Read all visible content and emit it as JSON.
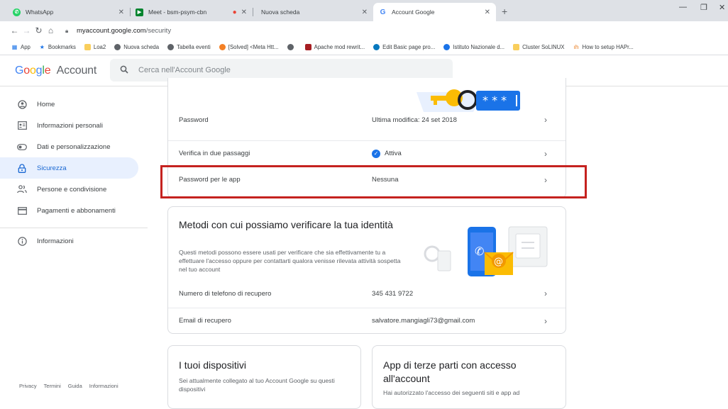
{
  "tabs": [
    {
      "title": "WhatsApp",
      "color": "#25d366"
    },
    {
      "title": "Meet - bsm-psym-cbn",
      "color": "#00832d"
    },
    {
      "title": "Nuova scheda",
      "color": "#ea4335"
    },
    {
      "title": "Account Google",
      "color": "#4285f4"
    }
  ],
  "address": {
    "host": "myaccount.google.com",
    "path": "/security"
  },
  "bookmarks": [
    "App",
    "Bookmarks",
    "Loa2",
    "Nuova scheda",
    "Tabella eventi",
    "[Solved] <Meta Htt...",
    "",
    "Apache mod rewrit...",
    "Edit Basic page pro...",
    "Istituto Nazionale d...",
    "Cluster SoLINUX",
    "How to setup HAPr..."
  ],
  "header": {
    "logo_google": "Google",
    "logo_account": "Account",
    "search_placeholder": "Cerca nell'Account Google"
  },
  "sidebar": {
    "items": [
      {
        "label": "Home",
        "icon": "home-icon"
      },
      {
        "label": "Informazioni personali",
        "icon": "id-card-icon"
      },
      {
        "label": "Dati e personalizzazione",
        "icon": "toggle-icon"
      },
      {
        "label": "Sicurezza",
        "icon": "lock-icon"
      },
      {
        "label": "Persone e condivisione",
        "icon": "people-icon"
      },
      {
        "label": "Pagamenti e abbonamenti",
        "icon": "card-icon"
      },
      {
        "label": "Informazioni",
        "icon": "info-icon"
      }
    ],
    "footer": [
      "Privacy",
      "Termini",
      "Guida",
      "Informazioni"
    ]
  },
  "signin": {
    "rows": [
      {
        "label": "Password",
        "value": "Ultima modifica: 24 set 2018"
      },
      {
        "label": "Verifica in due passaggi",
        "value": "Attiva"
      },
      {
        "label": "Password per le app",
        "value": "Nessuna"
      }
    ]
  },
  "verify": {
    "title": "Metodi con cui possiamo verificare la tua identità",
    "desc": "Questi metodi possono essere usati per verificare che sia effettivamente tu a effettuare l'accesso oppure per contattarti qualora venisse rilevata attività sospetta nel tuo account",
    "rows": [
      {
        "label": "Numero di telefono di recupero",
        "value": "345 431 9722"
      },
      {
        "label": "Email di recupero",
        "value": "salvatore.mangiagli73@gmail.com"
      }
    ]
  },
  "devices": {
    "title": "I tuoi dispositivi",
    "desc": "Sei attualmente collegato al tuo Account Google su questi dispositivi"
  },
  "thirdparty": {
    "title": "App di terze parti con accesso all'account",
    "desc": "Hai autorizzato l'accesso dei seguenti siti e app ad"
  },
  "colors": {
    "accent": "#1a73e8",
    "highlight": "#c5221f"
  }
}
